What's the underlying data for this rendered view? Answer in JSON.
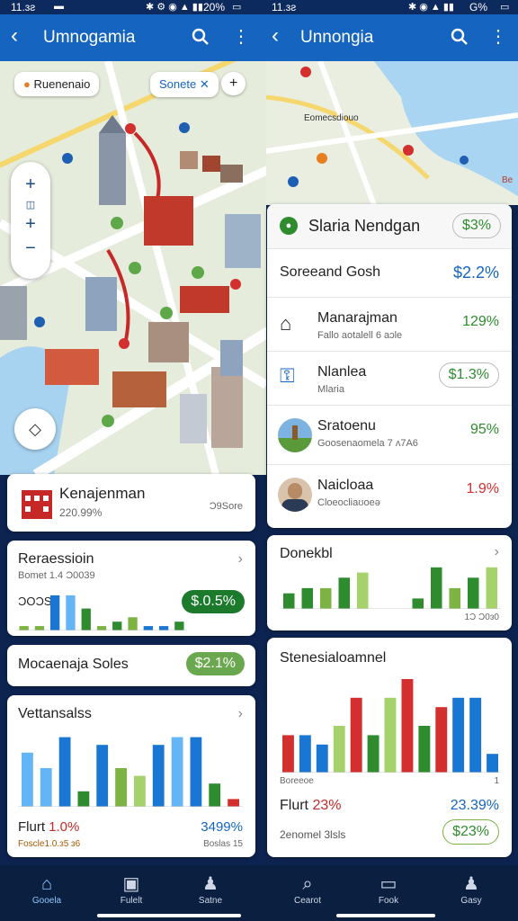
{
  "left": {
    "status": {
      "time": "11.ɜƨ",
      "battery": "20%"
    },
    "appbar": {
      "title": "Umnogamia"
    },
    "map_chips": {
      "place": "Ruenenaio",
      "filter": "Sonete"
    },
    "summary_card": {
      "title": "Kenajenman",
      "subtitle": "220.99%",
      "side": "Ɔ9Sore"
    },
    "chart_card_1": {
      "title": "Reraessioin",
      "subtitle": "Bomet 1.4 Ɔ0039",
      "label": "ƆOƆS",
      "badge": "$.0.5%",
      "chart_data": {
        "type": "bar",
        "values": [
          1,
          1,
          8,
          8,
          5,
          1,
          2,
          3,
          1,
          1,
          2
        ],
        "colors": [
          "#7cb342",
          "#7cb342",
          "#1976d2",
          "#64b5f6",
          "#2e8b2e",
          "#7cb342",
          "#2e8b2e",
          "#7cb342",
          "#1976d2",
          "#1976d2",
          "#2e8b2e"
        ],
        "ylim": [
          0,
          9
        ]
      }
    },
    "promo_bar": {
      "label": "Mocaenaja Soles",
      "badge": "$2.1%"
    },
    "chart_card_2": {
      "title": "Vettansalss",
      "footer_left_label": "Flurt",
      "footer_left_value": "1.0%",
      "footer_left_sub": "Foscle1.0.ɜ5 ɜ6",
      "footer_right_value": "3499%",
      "footer_right_sub": "Boslas 15",
      "chart_data": {
        "type": "bar",
        "values": [
          7,
          5,
          9,
          2,
          8,
          5,
          4,
          8,
          9,
          9,
          3,
          1
        ],
        "colors": [
          "#64b5f6",
          "#64b5f6",
          "#1976d2",
          "#2e8b2e",
          "#1976d2",
          "#7cb342",
          "#a5d26b",
          "#1976d2",
          "#64b5f6",
          "#1976d2",
          "#2e8b2e",
          "#d32f2f"
        ],
        "ylim": [
          0,
          10
        ]
      }
    }
  },
  "right": {
    "status": {
      "time": "11.ɜƨ",
      "battery": "G%"
    },
    "appbar": {
      "title": "Unnongia"
    },
    "map_labels": {
      "tag1": "Eomecsdiouo",
      "tag2": "Be"
    },
    "list_header": {
      "title": "Slaria Nendgan",
      "badge": "$3%"
    },
    "list_subheader": {
      "title": "Soreeand Gosh",
      "value": "$2.2%"
    },
    "list": [
      {
        "name": "Manarajman",
        "sub": "Fallo aotalell 6 aɔle",
        "value": "129%",
        "color": "#2e8b2e",
        "icon": "storefront-icon"
      },
      {
        "name": "Nlanlea",
        "sub": "Mlaria",
        "value": "$1.3%",
        "color": "#2e8b2e",
        "icon": "key-icon"
      },
      {
        "name": "Sratoenu",
        "sub": "Goosenaomela 7 ʌ7A6",
        "value": "95%",
        "color": "#2e8b2e",
        "icon": "landscape-icon"
      },
      {
        "name": "Naicloaa",
        "sub": "Cloeocliaʊoeǝ",
        "value": "1.9%",
        "color": "#d32f2f",
        "icon": "person-icon"
      }
    ],
    "chart_card_1": {
      "title": "Donekbl",
      "footer": "1Ɔ Ɔ0ɜ0",
      "chart_data": {
        "type": "bar",
        "values": [
          3,
          4,
          4,
          6,
          7,
          0,
          0,
          2,
          8,
          4,
          6,
          8
        ],
        "colors": [
          "#2e8b2e",
          "#2e8b2e",
          "#7cb342",
          "#2e8b2e",
          "#a5d26b",
          "#fff",
          "#fff",
          "#2e8b2e",
          "#2e8b2e",
          "#7cb342",
          "#2e8b2e",
          "#a5d26b"
        ],
        "ylim": [
          0,
          9
        ]
      }
    },
    "chart_card_2": {
      "title": "Stenesialoamnel",
      "axis_left": "Boreeoe",
      "axis_right": "1",
      "footer_left_label": "Flurt",
      "footer_left_value": "23%",
      "footer_left_sub": "2enomel 3lsls",
      "footer_right_value": "23.39%",
      "footer_right_badge": "$23%",
      "chart_data": {
        "type": "bar",
        "values": [
          4,
          4,
          3,
          5,
          8,
          4,
          8,
          10,
          5,
          7,
          8,
          8,
          2
        ],
        "colors": [
          "#d32f2f",
          "#1976d2",
          "#1976d2",
          "#a5d26b",
          "#d32f2f",
          "#2e8b2e",
          "#a5d26b",
          "#d32f2f",
          "#2e8b2e",
          "#d32f2f",
          "#1976d2",
          "#1976d2",
          "#1976d2"
        ],
        "ylim": [
          0,
          10
        ]
      }
    }
  },
  "nav": [
    {
      "label": "Gooela",
      "icon": "home-icon"
    },
    {
      "label": "Fulelt",
      "icon": "square-icon"
    },
    {
      "label": "Satne",
      "icon": "person-icon"
    },
    {
      "label": "Cearot",
      "icon": "search-icon"
    },
    {
      "label": "Fook",
      "icon": "card-icon"
    },
    {
      "label": "Gasy",
      "icon": "account-icon"
    }
  ]
}
